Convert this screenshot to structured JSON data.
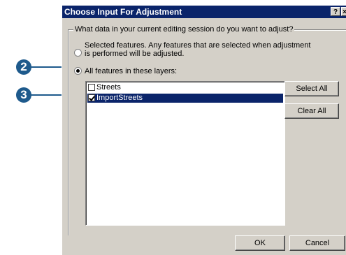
{
  "dialog": {
    "title": "Choose Input For Adjustment",
    "help_button": "?",
    "close_button": "×"
  },
  "group": {
    "legend": "What data in your current editing session do you want to adjust?"
  },
  "options": {
    "selected_features": {
      "line1": "Selected features.  Any features that are selected when adjustment",
      "line2": "is performed will be adjusted.",
      "checked": false
    },
    "all_features": {
      "label": "All features in these layers:",
      "checked": true
    }
  },
  "layers": [
    {
      "name": "Streets",
      "checked": false,
      "selected": false
    },
    {
      "name": "ImportStreets",
      "checked": true,
      "selected": true
    }
  ],
  "buttons": {
    "select_all": "Select All",
    "clear_all": "Clear All",
    "ok": "OK",
    "cancel": "Cancel"
  },
  "callouts": {
    "step_2": "2",
    "step_3": "3",
    "color": "#1e5a8c"
  },
  "colors": {
    "titlebar": "#0a246a",
    "dialog_bg": "#d4d0c8",
    "selection": "#0a246a"
  }
}
